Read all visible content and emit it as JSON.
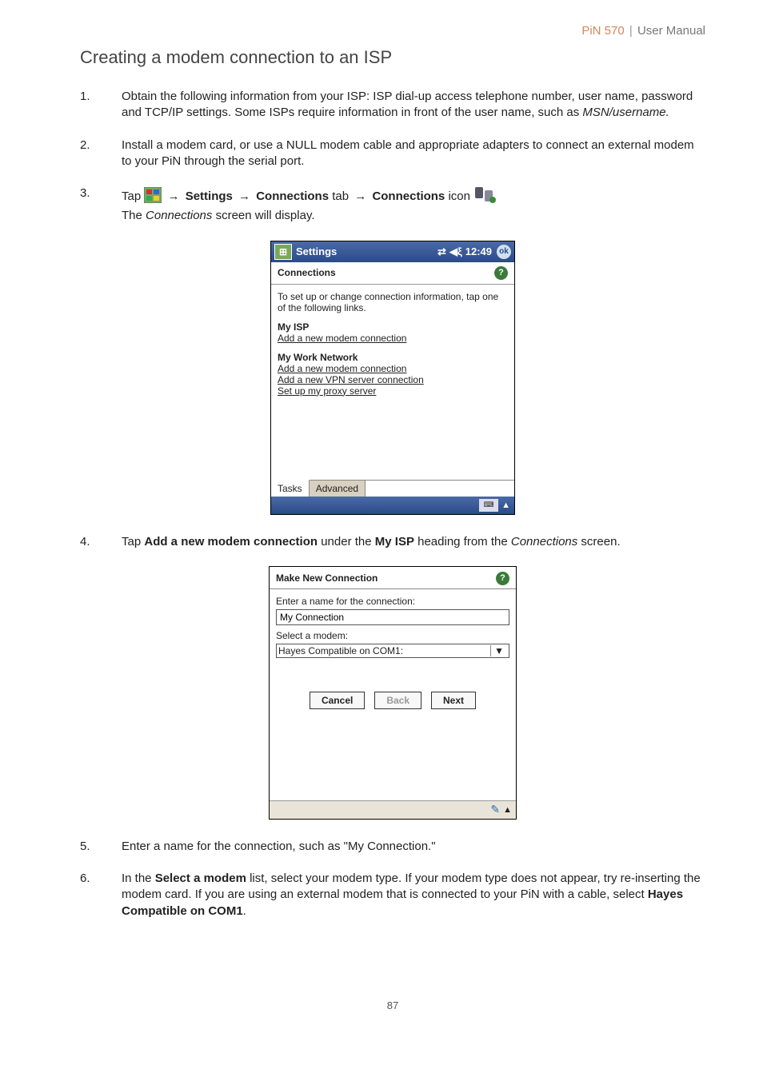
{
  "header": {
    "product": "PiN 570",
    "separator": "|",
    "title": "User Manual"
  },
  "section_title": "Creating a modem connection to an ISP",
  "steps": {
    "s1": {
      "num": "1.",
      "part1": "Obtain the following information from your ISP: ISP dial-up access telephone number, user name, password and TCP/IP settings. Some ISPs require information in front of the user name, such as ",
      "italic": "MSN/username."
    },
    "s2": {
      "num": "2.",
      "text": "Install a modem card, or use a NULL modem cable and appropriate adapters to connect an external modem to your PiN through the serial port."
    },
    "s3": {
      "num": "3.",
      "lead": "Tap ",
      "arrow": "→",
      "settings": " Settings ",
      "conn_tab": " Connections",
      "tab_word": " tab ",
      "conn_icon": " Connections",
      "icon_word": " icon ",
      "line2a": "The ",
      "line2i": "Connections",
      "line2b": " screen will display."
    },
    "s4": {
      "num": "4.",
      "t1": "Tap ",
      "b1": "Add a new modem connection",
      "t2": " under the ",
      "b2": "My ISP",
      "t3": " heading from the ",
      "i1": "Connections",
      "t4": " screen."
    },
    "s5": {
      "num": "5.",
      "text": "Enter a name for the connection, such as \"My Connection.\""
    },
    "s6": {
      "num": "6.",
      "t1": "In the ",
      "b1": "Select a modem",
      "t2": " list, select your modem type. If your modem type does not appear, try re-inserting the modem card. If you are using an external modem that is connected to your PiN with a cable, select ",
      "b2": "Hayes Compatible on COM1",
      "t3": "."
    }
  },
  "screenshot1": {
    "titlebar": {
      "title": "Settings",
      "time": "12:49",
      "ok": "ok"
    },
    "subtitle": "Connections",
    "intro": "To set up or change connection information, tap one of the following links.",
    "group1": {
      "title": "My ISP",
      "link1": "Add a new modem connection"
    },
    "group2": {
      "title": "My Work Network",
      "link1": "Add a new modem connection",
      "link2": "Add a new VPN server connection",
      "link3": "Set up my proxy server"
    },
    "tabs": {
      "t1": "Tasks",
      "t2": "Advanced"
    }
  },
  "screenshot2": {
    "title": "Make New Connection",
    "label1": "Enter a name for the connection:",
    "input1": "My Connection",
    "label2": "Select a modem:",
    "select1": "Hayes Compatible on COM1:",
    "btn_cancel": "Cancel",
    "btn_back": "Back",
    "btn_next": "Next"
  },
  "footer": {
    "page": "87"
  }
}
